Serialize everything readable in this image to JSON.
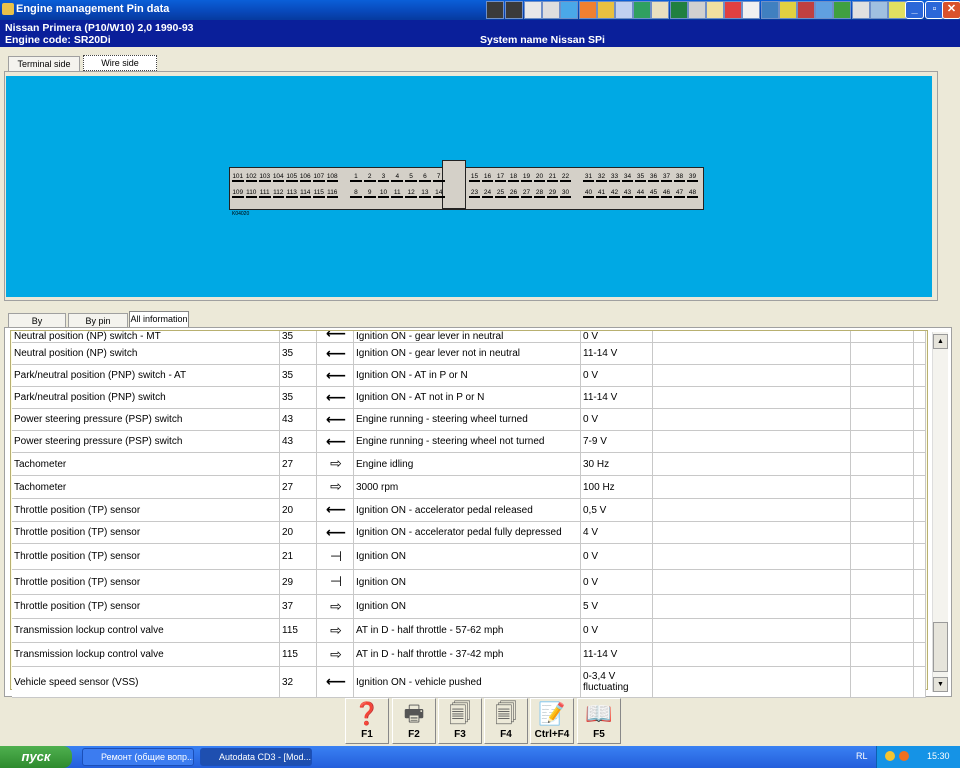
{
  "window": {
    "title": "Engine management Pin data"
  },
  "info": {
    "vehicle": "Nissan   Primera (P10/W10) 2,0  1990-93",
    "engine_code": "Engine code: SR20Di",
    "system_name": "System name Nissan SPi"
  },
  "view_tabs": [
    "Terminal side",
    "Wire side"
  ],
  "connector": {
    "left_top": [
      "101",
      "102",
      "103",
      "104",
      "105",
      "106",
      "107",
      "108"
    ],
    "left_bottom": [
      "109",
      "110",
      "111",
      "112",
      "113",
      "114",
      "115",
      "116"
    ],
    "mid_top": [
      "1",
      "2",
      "3",
      "4",
      "5",
      "6",
      "7"
    ],
    "mid_bottom": [
      "8",
      "9",
      "10",
      "11",
      "12",
      "13",
      "14"
    ],
    "right_top": [
      "15",
      "16",
      "17",
      "18",
      "19",
      "20",
      "21",
      "22",
      "31",
      "32",
      "33",
      "34",
      "35",
      "36",
      "37",
      "38",
      "39"
    ],
    "right_bottom": [
      "23",
      "24",
      "25",
      "26",
      "27",
      "28",
      "29",
      "30",
      "40",
      "41",
      "42",
      "43",
      "44",
      "45",
      "46",
      "47",
      "48"
    ],
    "label": "K04020"
  },
  "info_tabs": [
    "By component",
    "By pin number",
    "All information"
  ],
  "table": {
    "rows": [
      {
        "component": "Neutral position (NP) switch - MT",
        "pin": "35",
        "arrow": "in",
        "condition": "Ignition ON - gear lever in neutral",
        "value": "0 V"
      },
      {
        "component": "Neutral position (NP) switch",
        "pin": "35",
        "arrow": "in",
        "condition": "Ignition ON - gear lever not in neutral",
        "value": "11-14 V"
      },
      {
        "component": "Park/neutral position (PNP) switch - AT",
        "pin": "35",
        "arrow": "in",
        "condition": "Ignition ON - AT in P or N",
        "value": "0 V"
      },
      {
        "component": "Park/neutral position (PNP) switch",
        "pin": "35",
        "arrow": "in",
        "condition": "Ignition ON - AT not in P or N",
        "value": "11-14 V"
      },
      {
        "component": "Power steering pressure (PSP) switch",
        "pin": "43",
        "arrow": "in",
        "condition": "Engine running - steering wheel turned",
        "value": "0 V"
      },
      {
        "component": "Power steering pressure (PSP) switch",
        "pin": "43",
        "arrow": "in",
        "condition": "Engine running - steering wheel not turned",
        "value": "7-9 V"
      },
      {
        "component": "Tachometer",
        "pin": "27",
        "arrow": "out",
        "condition": "Engine idling",
        "value": "30 Hz"
      },
      {
        "component": "Tachometer",
        "pin": "27",
        "arrow": "out",
        "condition": "3000 rpm",
        "value": "100 Hz"
      },
      {
        "component": "Throttle position (TP) sensor",
        "pin": "20",
        "arrow": "in",
        "condition": "Ignition ON - accelerator pedal released",
        "value": "0,5 V"
      },
      {
        "component": "Throttle position (TP) sensor",
        "pin": "20",
        "arrow": "in",
        "condition": "Ignition ON - accelerator pedal fully depressed",
        "value": "4 V"
      },
      {
        "component": "Throttle position (TP) sensor",
        "pin": "21",
        "arrow": "ground",
        "condition": "Ignition ON",
        "value": "0 V"
      },
      {
        "component": "Throttle position (TP) sensor",
        "pin": "29",
        "arrow": "ground",
        "condition": "Ignition ON",
        "value": "0 V"
      },
      {
        "component": "Throttle position (TP) sensor",
        "pin": "37",
        "arrow": "out",
        "condition": "Ignition ON",
        "value": "5 V"
      },
      {
        "component": "Transmission lockup control valve",
        "pin": "115",
        "arrow": "out",
        "condition": "AT in D - half throttle - 57-62 mph",
        "value": "0 V"
      },
      {
        "component": "Transmission lockup control valve",
        "pin": "115",
        "arrow": "out",
        "condition": "AT in D - half throttle - 37-42 mph",
        "value": "11-14 V"
      },
      {
        "component": "Vehicle speed sensor (VSS)",
        "pin": "32",
        "arrow": "in",
        "condition": "Ignition ON - vehicle pushed",
        "value": "0-3,4 V fluctuating"
      }
    ]
  },
  "function_keys": [
    {
      "label": "F1",
      "icon": "help-icon"
    },
    {
      "label": "F2",
      "icon": "printer-icon"
    },
    {
      "label": "F3",
      "icon": "copy-icon"
    },
    {
      "label": "F4",
      "icon": "copy-all-icon"
    },
    {
      "label": "Ctrl+F4",
      "icon": "notes-icon"
    },
    {
      "label": "F5",
      "icon": "book-icon"
    }
  ],
  "taskbar": {
    "start": "пуск",
    "tasks": [
      "Ремонт (общие вопр...",
      "Autodata CD3 - [Mod..."
    ],
    "lang": "RL",
    "clock": "15:30"
  },
  "colors": {
    "diagram_bg": "#00a9e4",
    "info_bar": "#0a1f9a",
    "title_bar": "#0847b8"
  }
}
